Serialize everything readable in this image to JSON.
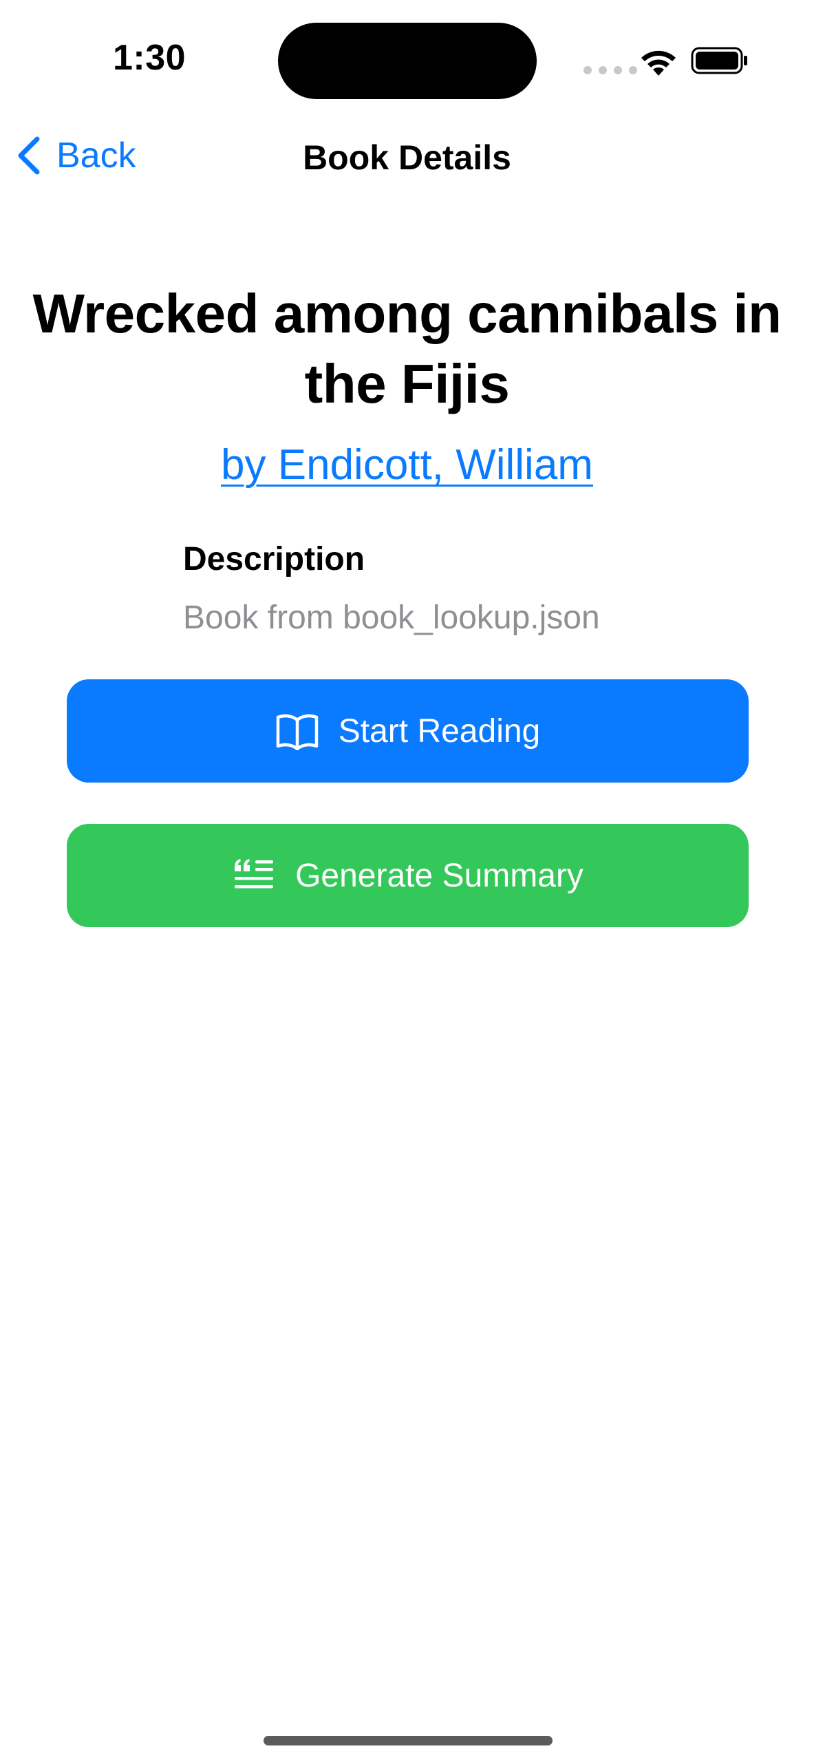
{
  "status_bar": {
    "time": "1:30"
  },
  "nav": {
    "back_label": "Back",
    "title": "Book Details"
  },
  "book": {
    "title": "Wrecked among cannibals in the Fijis",
    "author_link": "by Endicott, William",
    "description_heading": "Description",
    "description": "Book from book_lookup.json"
  },
  "actions": {
    "start_reading": {
      "label": "Start Reading",
      "icon": "book-icon",
      "color": "#0a7aff"
    },
    "generate_summary": {
      "label": "Generate Summary",
      "icon": "text-quote-icon",
      "color": "#34c759"
    }
  },
  "colors": {
    "accent": "#0a7aff",
    "success": "#34c759",
    "secondary_text": "#8e8e93"
  }
}
